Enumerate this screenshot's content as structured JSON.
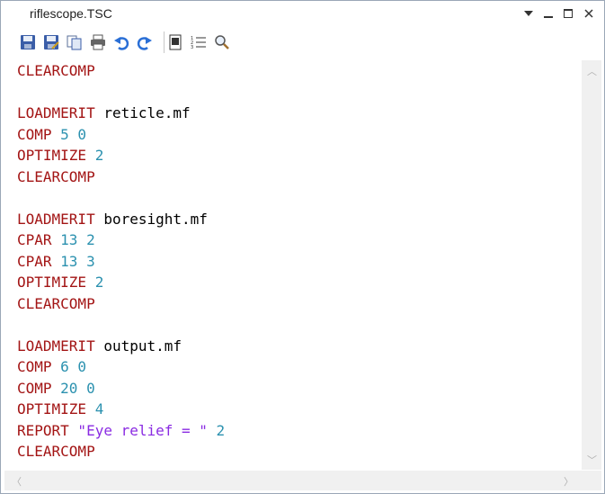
{
  "window": {
    "title": "riflescope.TSC",
    "controls": [
      "dropdown",
      "minimize",
      "maximize",
      "close"
    ]
  },
  "toolbar": {
    "buttons": [
      "save",
      "save-as",
      "copy",
      "print",
      "undo",
      "redo",
      "settings",
      "line-numbers",
      "find"
    ]
  },
  "editor": {
    "lines": [
      [
        {
          "t": "kw",
          "v": "CLEARCOMP"
        }
      ],
      [],
      [
        {
          "t": "kw",
          "v": "LOADMERIT"
        },
        {
          "t": "txt",
          "v": " reticle.mf"
        }
      ],
      [
        {
          "t": "kw",
          "v": "COMP"
        },
        {
          "t": "num",
          "v": " 5 0"
        }
      ],
      [
        {
          "t": "kw",
          "v": "OPTIMIZE"
        },
        {
          "t": "num",
          "v": " 2"
        }
      ],
      [
        {
          "t": "kw",
          "v": "CLEARCOMP"
        }
      ],
      [],
      [
        {
          "t": "kw",
          "v": "LOADMERIT"
        },
        {
          "t": "txt",
          "v": " boresight.mf"
        }
      ],
      [
        {
          "t": "kw",
          "v": "CPAR"
        },
        {
          "t": "num",
          "v": " 13 2"
        }
      ],
      [
        {
          "t": "kw",
          "v": "CPAR"
        },
        {
          "t": "num",
          "v": " 13 3"
        }
      ],
      [
        {
          "t": "kw",
          "v": "OPTIMIZE"
        },
        {
          "t": "num",
          "v": " 2"
        }
      ],
      [
        {
          "t": "kw",
          "v": "CLEARCOMP"
        }
      ],
      [],
      [
        {
          "t": "kw",
          "v": "LOADMERIT"
        },
        {
          "t": "txt",
          "v": " output.mf"
        }
      ],
      [
        {
          "t": "kw",
          "v": "COMP"
        },
        {
          "t": "num",
          "v": " 6 0"
        }
      ],
      [
        {
          "t": "kw",
          "v": "COMP"
        },
        {
          "t": "num",
          "v": " 20 0"
        }
      ],
      [
        {
          "t": "kw",
          "v": "OPTIMIZE"
        },
        {
          "t": "num",
          "v": " 4"
        }
      ],
      [
        {
          "t": "kw",
          "v": "REPORT"
        },
        {
          "t": "str",
          "v": " \"Eye relief = \""
        },
        {
          "t": "num",
          "v": " 2"
        }
      ],
      [
        {
          "t": "kw",
          "v": "CLEARCOMP"
        }
      ]
    ]
  },
  "colors": {
    "keyword": "#a31515",
    "number": "#2b91af",
    "string": "#8a2be2",
    "text": "#000000"
  }
}
